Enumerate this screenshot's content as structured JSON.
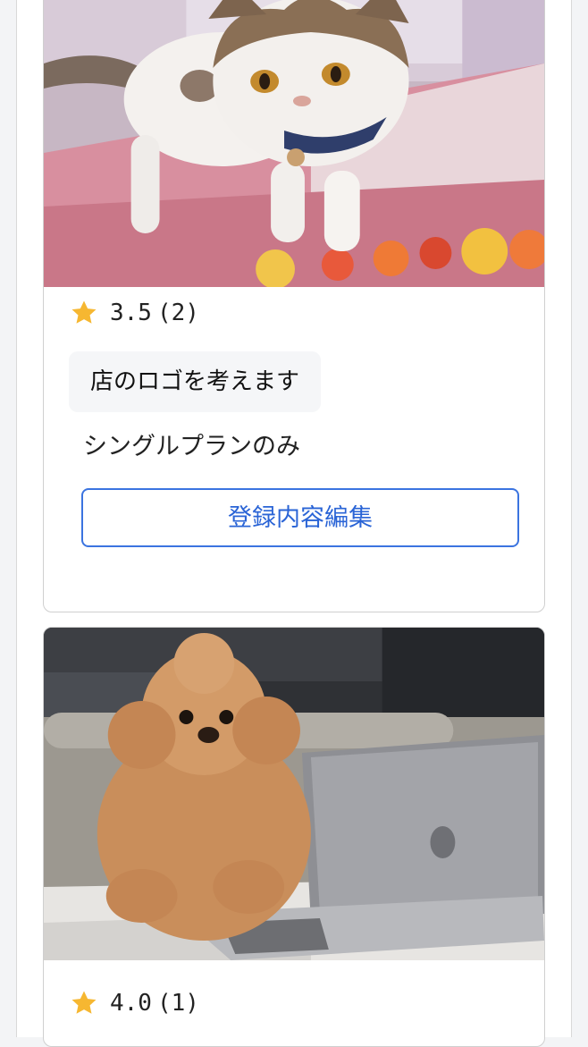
{
  "listings": [
    {
      "photo_subject": "exotic-shorthair-cat",
      "rating": "3.5",
      "review_count": "(2)",
      "title": "店のロゴを考えます",
      "plan": "シングルプランのみ",
      "edit_button": "登録内容編集"
    },
    {
      "photo_subject": "toy-poodle-with-laptop",
      "rating": "4.0",
      "review_count": "(1)"
    }
  ],
  "colors": {
    "star": "#f6b731",
    "button_border": "#3b74e0",
    "button_text": "#2a64d6",
    "tag_background": "#f5f6f8"
  }
}
